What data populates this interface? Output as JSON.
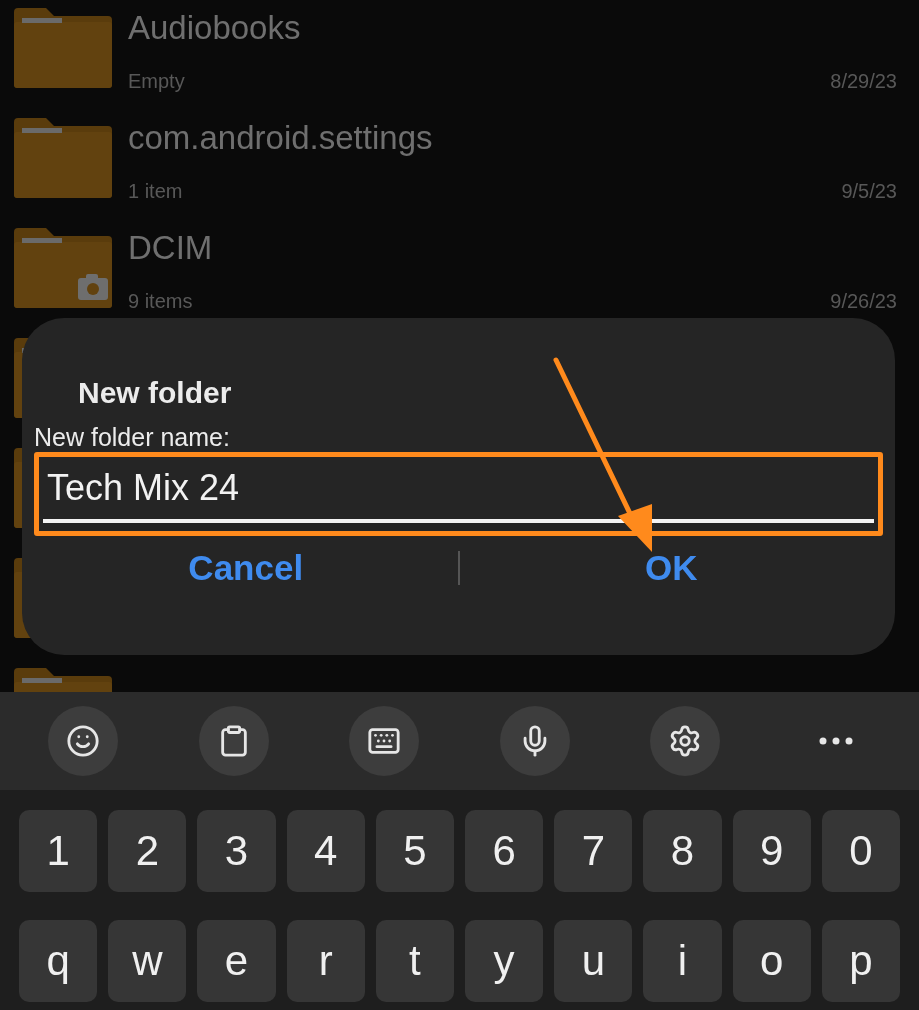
{
  "files": [
    {
      "kind": "folder",
      "name": "Audiobooks",
      "detail": "Empty",
      "date": "8/29/23",
      "camera": false
    },
    {
      "kind": "folder",
      "name": "com.android.settings",
      "detail": "1 item",
      "date": "9/5/23",
      "camera": false
    },
    {
      "kind": "folder",
      "name": "DCIM",
      "detail": "9 items",
      "date": "9/26/23",
      "camera": true
    },
    {
      "kind": "covered"
    },
    {
      "kind": "covered"
    },
    {
      "kind": "covered"
    },
    {
      "kind": "covered"
    }
  ],
  "dialog": {
    "title": "New folder",
    "label": "New folder name:",
    "value": "Tech Mix 24",
    "highlighted": true,
    "buttons": [
      "Cancel",
      "OK"
    ]
  },
  "keyboard": {
    "toolbar": [
      {
        "kind": "emoji"
      },
      {
        "kind": "clipboard"
      },
      {
        "kind": "keypad"
      },
      {
        "kind": "mic"
      },
      {
        "kind": "settings"
      },
      {
        "kind": "more"
      }
    ],
    "rows": [
      [
        "1",
        "2",
        "3",
        "4",
        "5",
        "6",
        "7",
        "8",
        "9",
        "0"
      ],
      [
        "q",
        "w",
        "e",
        "r",
        "t",
        "y",
        "u",
        "i",
        "o",
        "p"
      ]
    ]
  }
}
